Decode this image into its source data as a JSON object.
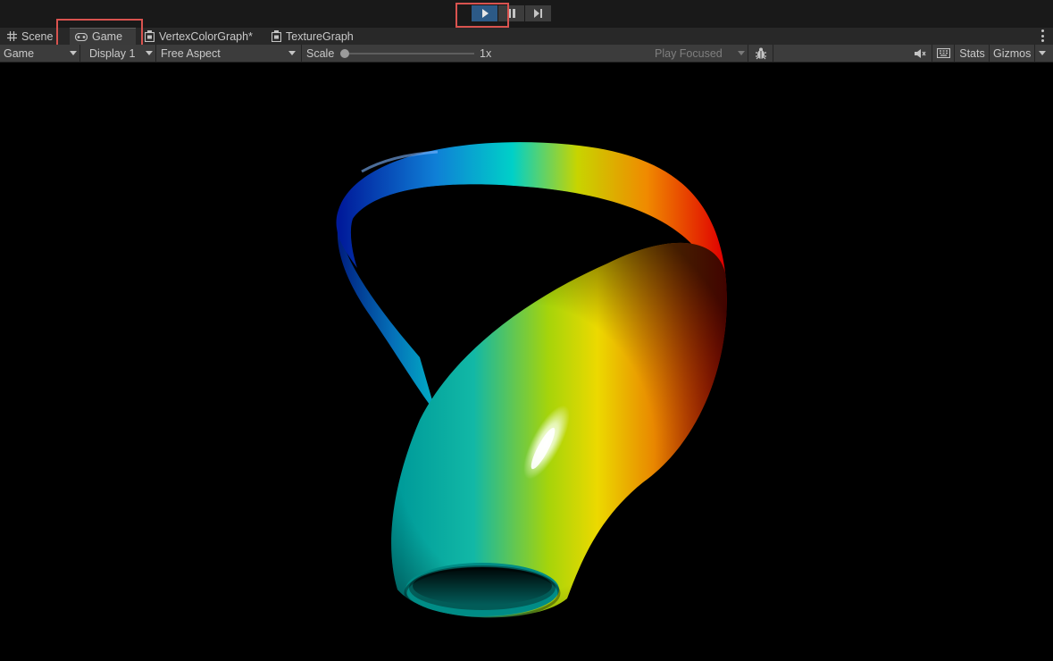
{
  "playbar": {
    "play_icon": "play-icon",
    "pause_icon": "pause-icon",
    "step_icon": "step-icon"
  },
  "tabs": [
    {
      "label": "Scene",
      "icon": "grid-icon"
    },
    {
      "label": "Game",
      "icon": "gamepad-icon"
    },
    {
      "label": "VertexColorGraph*",
      "icon": "graph-icon"
    },
    {
      "label": "TextureGraph",
      "icon": "graph-icon"
    }
  ],
  "toolbar": {
    "mode_select": "Game",
    "display_select": "Display 1",
    "aspect_select": "Free Aspect",
    "scale_label": "Scale",
    "scale_value": "1x",
    "scale_fraction": 0.0,
    "play_focused": "Play Focused",
    "stats_label": "Stats",
    "gizmos_label": "Gizmos"
  },
  "colors": {
    "highlight": "#d9534f",
    "play_active": "#2c5a87",
    "toolbar_bg": "#3c3c3c",
    "tabbar_bg": "#282828"
  }
}
